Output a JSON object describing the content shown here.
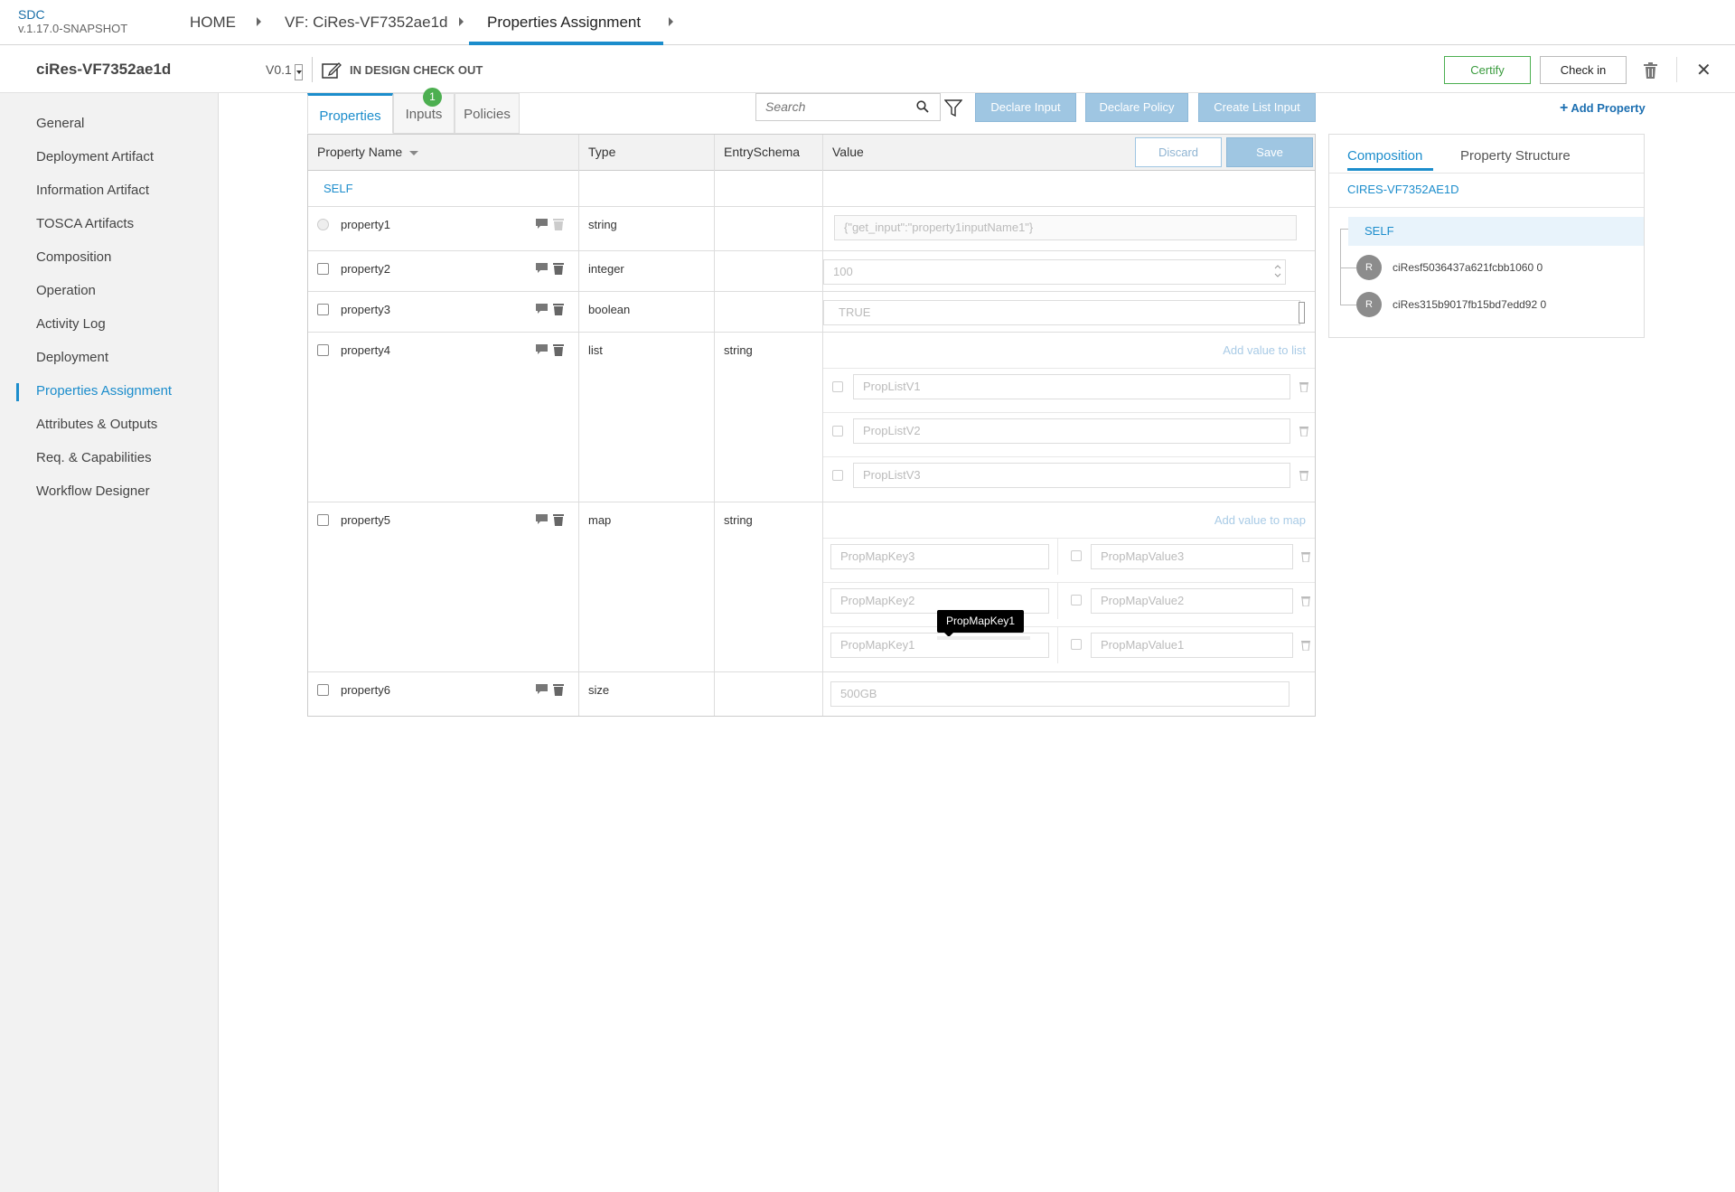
{
  "app": {
    "name": "SDC",
    "version": "v.1.17.0-SNAPSHOT"
  },
  "breadcrumbs": [
    "HOME",
    "VF: CiRes-VF7352ae1d",
    "Properties Assignment"
  ],
  "header": {
    "component_name": "ciRes-VF7352ae1d",
    "version": "V0.1",
    "status": "IN DESIGN CHECK OUT",
    "certify_label": "Certify",
    "checkin_label": "Check in",
    "close_glyph": "✕"
  },
  "sidebar": {
    "items": [
      {
        "label": "General"
      },
      {
        "label": "Deployment Artifact"
      },
      {
        "label": "Information Artifact"
      },
      {
        "label": "TOSCA Artifacts"
      },
      {
        "label": "Composition"
      },
      {
        "label": "Operation"
      },
      {
        "label": "Activity Log"
      },
      {
        "label": "Deployment"
      },
      {
        "label": "Properties Assignment",
        "active": true
      },
      {
        "label": "Attributes & Outputs"
      },
      {
        "label": "Req. & Capabilities"
      },
      {
        "label": "Workflow Designer"
      }
    ]
  },
  "tabs": [
    {
      "label": "Properties",
      "active": true
    },
    {
      "label": "Inputs",
      "badge": "1"
    },
    {
      "label": "Policies"
    }
  ],
  "toolbar": {
    "search_placeholder": "Search",
    "declare_input": "Declare Input",
    "declare_policy": "Declare Policy",
    "create_list_input": "Create List Input",
    "add_property": "Add Property"
  },
  "table": {
    "headers": {
      "name": "Property Name",
      "type": "Type",
      "schema": "EntrySchema",
      "value": "Value"
    },
    "discard_label": "Discard",
    "save_label": "Save",
    "group": "SELF",
    "rows": [
      {
        "name": "property1",
        "type": "string",
        "schema": "",
        "value": "{\"get_input\":\"property1inputName1\"}"
      },
      {
        "name": "property2",
        "type": "integer",
        "schema": "",
        "value": "100"
      },
      {
        "name": "property3",
        "type": "boolean",
        "schema": "",
        "value": "TRUE"
      },
      {
        "name": "property4",
        "type": "list",
        "schema": "string",
        "add_label": "Add value to list",
        "items": [
          "PropListV1",
          "PropListV2",
          "PropListV3"
        ]
      },
      {
        "name": "property5",
        "type": "map",
        "schema": "string",
        "add_label": "Add value to map",
        "entries": [
          {
            "key": "PropMapKey3",
            "value": "PropMapValue3"
          },
          {
            "key": "PropMapKey2",
            "value": "PropMapValue2"
          },
          {
            "key": "PropMapKey1",
            "value": "PropMapValue1"
          }
        ]
      },
      {
        "name": "property6",
        "type": "size",
        "schema": "",
        "value": "500GB"
      }
    ]
  },
  "tooltip": "PropMapKey1",
  "right_panel": {
    "tabs": [
      "Composition",
      "Property Structure"
    ],
    "root": "CIRES-VF7352AE1D",
    "self": "SELF",
    "instances": [
      {
        "avatar": "R",
        "name": "ciResf5036437a621fcbb1060 0"
      },
      {
        "avatar": "R",
        "name": "ciRes315b9017fb15bd7edd92 0"
      }
    ]
  },
  "colors": {
    "accent": "#1c8dcc",
    "certify": "#4caf50",
    "button_disabled": "#9fc6e2"
  }
}
